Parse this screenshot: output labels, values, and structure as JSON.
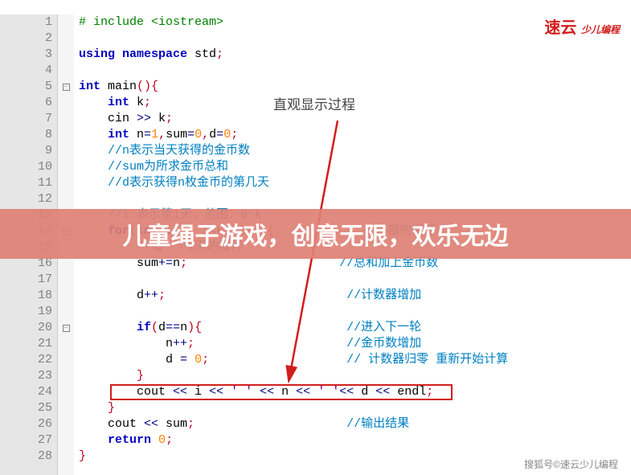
{
  "logo": {
    "main": "速云",
    "sub": "少儿编程"
  },
  "annotation": "直观显示过程",
  "banner": "儿童绳子游戏，创意无限，欢乐无边",
  "watermark": "搜狐号©速云少儿编程",
  "fold_lines": [
    5,
    14,
    20
  ],
  "code": {
    "lines": [
      {
        "n": 1,
        "segs": [
          [
            "green",
            "# include <iostream>"
          ]
        ]
      },
      {
        "n": 2,
        "segs": []
      },
      {
        "n": 3,
        "segs": [
          [
            "blue",
            "using namespace"
          ],
          [
            "black",
            " std"
          ],
          [
            "red",
            ";"
          ]
        ]
      },
      {
        "n": 4,
        "segs": []
      },
      {
        "n": 5,
        "segs": [
          [
            "blue",
            "int"
          ],
          [
            "black",
            " main"
          ],
          [
            "red",
            "(){"
          ]
        ]
      },
      {
        "n": 6,
        "segs": [
          [
            "black",
            "    "
          ],
          [
            "blue",
            "int"
          ],
          [
            "black",
            " k"
          ],
          [
            "red",
            ";"
          ]
        ]
      },
      {
        "n": 7,
        "segs": [
          [
            "black",
            "    cin "
          ],
          [
            "navy",
            ">>"
          ],
          [
            "black",
            " k"
          ],
          [
            "red",
            ";"
          ]
        ]
      },
      {
        "n": 8,
        "segs": [
          [
            "black",
            "    "
          ],
          [
            "blue",
            "int"
          ],
          [
            "black",
            " n"
          ],
          [
            "navy",
            "="
          ],
          [
            "num",
            "1"
          ],
          [
            "red",
            ","
          ],
          [
            "black",
            "sum"
          ],
          [
            "navy",
            "="
          ],
          [
            "num",
            "0"
          ],
          [
            "red",
            ","
          ],
          [
            "black",
            "d"
          ],
          [
            "navy",
            "="
          ],
          [
            "num",
            "0"
          ],
          [
            "red",
            ";"
          ]
        ]
      },
      {
        "n": 9,
        "segs": [
          [
            "black",
            "    "
          ],
          [
            "comment",
            "//n表示当天获得的金币数"
          ]
        ]
      },
      {
        "n": 10,
        "segs": [
          [
            "black",
            "    "
          ],
          [
            "comment",
            "//sum为所求金币总和"
          ]
        ]
      },
      {
        "n": 11,
        "segs": [
          [
            "black",
            "    "
          ],
          [
            "comment",
            "//d表示获得n枚金币的第几天"
          ]
        ]
      },
      {
        "n": 12,
        "segs": []
      },
      {
        "n": 13,
        "segs": [
          [
            "black",
            "    "
          ],
          [
            "comment",
            "//i:表示第i天，范围：0~k"
          ]
        ]
      },
      {
        "n": 14,
        "segs": [
          [
            "black",
            "    "
          ],
          [
            "blue",
            "for"
          ],
          [
            "red",
            "("
          ],
          [
            "blue",
            "int"
          ],
          [
            "black",
            " i"
          ],
          [
            "navy",
            "="
          ],
          [
            "num",
            "0"
          ],
          [
            "red",
            ";"
          ],
          [
            "black",
            " i"
          ],
          [
            "navy",
            "<"
          ],
          [
            "black",
            "k"
          ],
          [
            "red",
            ";"
          ],
          [
            "black",
            " i"
          ],
          [
            "navy",
            "++"
          ],
          [
            "red",
            "){"
          ],
          [
            "black",
            "            "
          ],
          [
            "comment",
            "//外部的循环"
          ]
        ]
      },
      {
        "n": 15,
        "segs": [
          [
            "black",
            "        "
          ],
          [
            "comment",
            "//每一个i天的操作"
          ]
        ]
      },
      {
        "n": 16,
        "segs": [
          [
            "black",
            "        sum"
          ],
          [
            "navy",
            "+="
          ],
          [
            "black",
            "n"
          ],
          [
            "red",
            ";"
          ],
          [
            "black",
            "                     "
          ],
          [
            "comment",
            "//总和加上金币数"
          ]
        ]
      },
      {
        "n": 17,
        "segs": []
      },
      {
        "n": 18,
        "segs": [
          [
            "black",
            "        d"
          ],
          [
            "navy",
            "++"
          ],
          [
            "red",
            ";"
          ],
          [
            "black",
            "                         "
          ],
          [
            "comment",
            "//计数器增加"
          ]
        ]
      },
      {
        "n": 19,
        "segs": []
      },
      {
        "n": 20,
        "segs": [
          [
            "black",
            "        "
          ],
          [
            "blue",
            "if"
          ],
          [
            "red",
            "("
          ],
          [
            "black",
            "d"
          ],
          [
            "navy",
            "=="
          ],
          [
            "black",
            "n"
          ],
          [
            "red",
            "){"
          ],
          [
            "black",
            "                    "
          ],
          [
            "comment",
            "//进入下一轮"
          ]
        ]
      },
      {
        "n": 21,
        "segs": [
          [
            "black",
            "            n"
          ],
          [
            "navy",
            "++"
          ],
          [
            "red",
            ";"
          ],
          [
            "black",
            "                     "
          ],
          [
            "comment",
            "//金币数增加"
          ]
        ]
      },
      {
        "n": 22,
        "segs": [
          [
            "black",
            "            d "
          ],
          [
            "navy",
            "="
          ],
          [
            "black",
            " "
          ],
          [
            "num",
            "0"
          ],
          [
            "red",
            ";"
          ],
          [
            "black",
            "                   "
          ],
          [
            "comment",
            "// 计数器归零 重新开始计算"
          ]
        ]
      },
      {
        "n": 23,
        "segs": [
          [
            "black",
            "        "
          ],
          [
            "red",
            "}"
          ]
        ]
      },
      {
        "n": 24,
        "segs": [
          [
            "black",
            "        cout "
          ],
          [
            "navy",
            "<<"
          ],
          [
            "black",
            " i "
          ],
          [
            "navy",
            "<<"
          ],
          [
            "black",
            " "
          ],
          [
            "purple",
            "' '"
          ],
          [
            "black",
            " "
          ],
          [
            "navy",
            "<<"
          ],
          [
            "black",
            " n "
          ],
          [
            "navy",
            "<<"
          ],
          [
            "black",
            " "
          ],
          [
            "purple",
            "' '"
          ],
          [
            "navy",
            "<<"
          ],
          [
            "black",
            " d "
          ],
          [
            "navy",
            "<<"
          ],
          [
            "black",
            " endl"
          ],
          [
            "red",
            ";"
          ]
        ]
      },
      {
        "n": 25,
        "segs": [
          [
            "black",
            "    "
          ],
          [
            "red",
            "}"
          ]
        ]
      },
      {
        "n": 26,
        "segs": [
          [
            "black",
            "    cout "
          ],
          [
            "navy",
            "<<"
          ],
          [
            "black",
            " sum"
          ],
          [
            "red",
            ";"
          ],
          [
            "black",
            "                     "
          ],
          [
            "comment",
            "//输出结果"
          ]
        ]
      },
      {
        "n": 27,
        "segs": [
          [
            "black",
            "    "
          ],
          [
            "blue",
            "return"
          ],
          [
            "black",
            " "
          ],
          [
            "num",
            "0"
          ],
          [
            "red",
            ";"
          ]
        ]
      },
      {
        "n": 28,
        "segs": [
          [
            "red",
            "}"
          ]
        ]
      }
    ]
  }
}
